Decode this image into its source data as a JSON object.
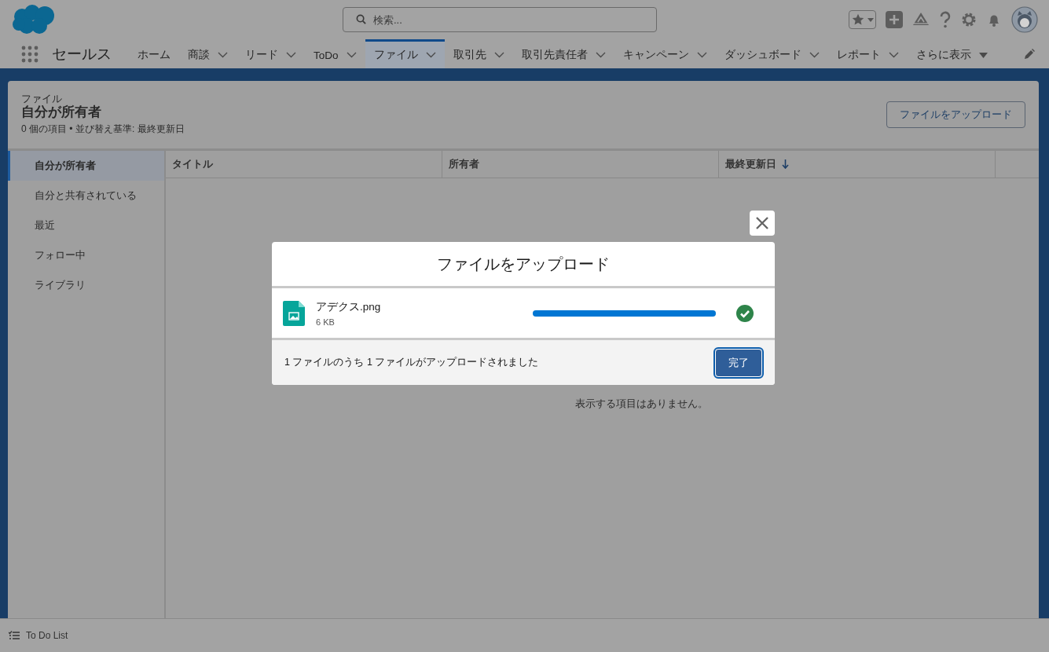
{
  "header": {
    "search_placeholder": "検索..."
  },
  "nav": {
    "app_name": "セールス",
    "items": [
      {
        "label": "ホーム",
        "menu": false,
        "selected": false
      },
      {
        "label": "商談",
        "menu": true,
        "selected": false
      },
      {
        "label": "リード",
        "menu": true,
        "selected": false
      },
      {
        "label": "ToDo",
        "menu": true,
        "selected": false
      },
      {
        "label": "ファイル",
        "menu": true,
        "selected": true
      },
      {
        "label": "取引先",
        "menu": true,
        "selected": false
      },
      {
        "label": "取引先責任者",
        "menu": true,
        "selected": false
      },
      {
        "label": "キャンペーン",
        "menu": true,
        "selected": false
      },
      {
        "label": "ダッシュボード",
        "menu": true,
        "selected": false
      },
      {
        "label": "レポート",
        "menu": true,
        "selected": false
      }
    ],
    "more": "さらに表示"
  },
  "list_header": {
    "object": "ファイル",
    "title": "自分が所有者",
    "meta": "0 個の項目 • 並び替え基準: 最終更新日",
    "upload_button": "ファイルをアップロード"
  },
  "sidebar": {
    "items": [
      {
        "label": "自分が所有者",
        "selected": true
      },
      {
        "label": "自分と共有されている",
        "selected": false
      },
      {
        "label": "最近",
        "selected": false
      },
      {
        "label": "フォロー中",
        "selected": false
      },
      {
        "label": "ライブラリ",
        "selected": false
      }
    ]
  },
  "table": {
    "columns": [
      {
        "label": "タイトル",
        "sorted": false
      },
      {
        "label": "所有者",
        "sorted": false
      },
      {
        "label": "最終更新日",
        "sorted": true
      }
    ],
    "empty_message": "表示する項目はありません。"
  },
  "modal": {
    "title": "ファイルをアップロード",
    "files": [
      {
        "name": "アデクス.png",
        "size": "6 KB",
        "level": 1,
        "done": true
      }
    ],
    "summary": "1 ファイルのうち 1 ファイルがアップロードされました",
    "done_button": "完了"
  },
  "utility_bar": {
    "items": [
      {
        "label": "To Do List"
      }
    ]
  }
}
